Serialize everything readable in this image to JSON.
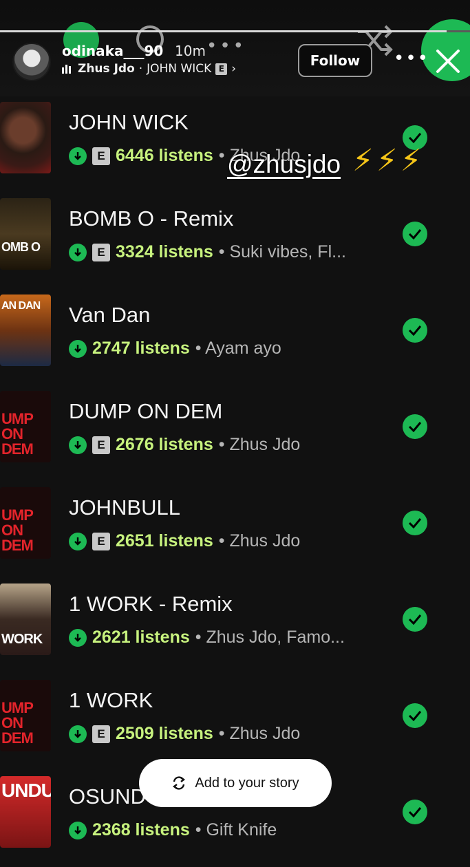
{
  "story": {
    "username": "odinaka___90",
    "time": "10m",
    "artist": "Zhus Jdo",
    "separator": "·",
    "song": "JOHN WICK",
    "explicit": "E",
    "chevron": "›",
    "follow_label": "Follow",
    "more_label": "•••",
    "progress": 0.95
  },
  "overlay": {
    "mention": "@zhusjdo",
    "bolts": "⚡⚡⚡"
  },
  "tracks": [
    {
      "title": "JOHN WICK",
      "explicit": true,
      "listens": "6446 listens",
      "artists": "• Zhus Jdo",
      "cover": "cover-john-wick"
    },
    {
      "title": "BOMB O - Remix",
      "explicit": true,
      "listens": "3324 listens",
      "artists": "• Suki vibes, Fl...",
      "cover": "cover-bomb-o"
    },
    {
      "title": "Van Dan",
      "explicit": false,
      "listens": "2747 listens",
      "artists": "• Ayam ayo",
      "cover": "cover-van-dan"
    },
    {
      "title": "DUMP ON DEM",
      "explicit": true,
      "listens": "2676 listens",
      "artists": "• Zhus Jdo",
      "cover": "cover-dump-on-dem"
    },
    {
      "title": "JOHNBULL",
      "explicit": true,
      "listens": "2651 listens",
      "artists": "• Zhus Jdo",
      "cover": "cover-dump-on-dem"
    },
    {
      "title": "1 WORK - Remix",
      "explicit": false,
      "listens": "2621 listens",
      "artists": "• Zhus Jdo, Famo...",
      "cover": "cover-1-work"
    },
    {
      "title": "1 WORK",
      "explicit": true,
      "listens": "2509 listens",
      "artists": "• Zhus Jdo",
      "cover": "cover-dump-on-dem"
    },
    {
      "title": "OSUNDU",
      "explicit": false,
      "listens": "2368 listens",
      "artists": "• Gift Knife",
      "cover": "cover-osundu"
    }
  ],
  "cover_text": {
    "dump": "UMP\nON\nDEM",
    "osundu": "UNDU",
    "bomb": "OMB O",
    "vandan": "AN DAN",
    "work": "WORK"
  },
  "add_story_label": "Add to your story",
  "colors": {
    "accent": "#1db954",
    "listens": "#c7f27e",
    "background": "#111111"
  }
}
